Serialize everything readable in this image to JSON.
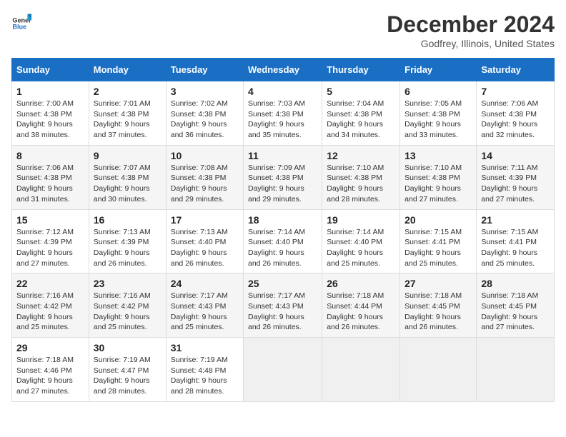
{
  "logo": {
    "line1": "General",
    "line2": "Blue"
  },
  "title": "December 2024",
  "subtitle": "Godfrey, Illinois, United States",
  "days_of_week": [
    "Sunday",
    "Monday",
    "Tuesday",
    "Wednesday",
    "Thursday",
    "Friday",
    "Saturday"
  ],
  "weeks": [
    [
      {
        "day": "1",
        "sunrise": "7:00 AM",
        "sunset": "4:38 PM",
        "daylight": "9 hours and 38 minutes."
      },
      {
        "day": "2",
        "sunrise": "7:01 AM",
        "sunset": "4:38 PM",
        "daylight": "9 hours and 37 minutes."
      },
      {
        "day": "3",
        "sunrise": "7:02 AM",
        "sunset": "4:38 PM",
        "daylight": "9 hours and 36 minutes."
      },
      {
        "day": "4",
        "sunrise": "7:03 AM",
        "sunset": "4:38 PM",
        "daylight": "9 hours and 35 minutes."
      },
      {
        "day": "5",
        "sunrise": "7:04 AM",
        "sunset": "4:38 PM",
        "daylight": "9 hours and 34 minutes."
      },
      {
        "day": "6",
        "sunrise": "7:05 AM",
        "sunset": "4:38 PM",
        "daylight": "9 hours and 33 minutes."
      },
      {
        "day": "7",
        "sunrise": "7:06 AM",
        "sunset": "4:38 PM",
        "daylight": "9 hours and 32 minutes."
      }
    ],
    [
      {
        "day": "8",
        "sunrise": "7:06 AM",
        "sunset": "4:38 PM",
        "daylight": "9 hours and 31 minutes."
      },
      {
        "day": "9",
        "sunrise": "7:07 AM",
        "sunset": "4:38 PM",
        "daylight": "9 hours and 30 minutes."
      },
      {
        "day": "10",
        "sunrise": "7:08 AM",
        "sunset": "4:38 PM",
        "daylight": "9 hours and 29 minutes."
      },
      {
        "day": "11",
        "sunrise": "7:09 AM",
        "sunset": "4:38 PM",
        "daylight": "9 hours and 29 minutes."
      },
      {
        "day": "12",
        "sunrise": "7:10 AM",
        "sunset": "4:38 PM",
        "daylight": "9 hours and 28 minutes."
      },
      {
        "day": "13",
        "sunrise": "7:10 AM",
        "sunset": "4:38 PM",
        "daylight": "9 hours and 27 minutes."
      },
      {
        "day": "14",
        "sunrise": "7:11 AM",
        "sunset": "4:39 PM",
        "daylight": "9 hours and 27 minutes."
      }
    ],
    [
      {
        "day": "15",
        "sunrise": "7:12 AM",
        "sunset": "4:39 PM",
        "daylight": "9 hours and 27 minutes."
      },
      {
        "day": "16",
        "sunrise": "7:13 AM",
        "sunset": "4:39 PM",
        "daylight": "9 hours and 26 minutes."
      },
      {
        "day": "17",
        "sunrise": "7:13 AM",
        "sunset": "4:40 PM",
        "daylight": "9 hours and 26 minutes."
      },
      {
        "day": "18",
        "sunrise": "7:14 AM",
        "sunset": "4:40 PM",
        "daylight": "9 hours and 26 minutes."
      },
      {
        "day": "19",
        "sunrise": "7:14 AM",
        "sunset": "4:40 PM",
        "daylight": "9 hours and 25 minutes."
      },
      {
        "day": "20",
        "sunrise": "7:15 AM",
        "sunset": "4:41 PM",
        "daylight": "9 hours and 25 minutes."
      },
      {
        "day": "21",
        "sunrise": "7:15 AM",
        "sunset": "4:41 PM",
        "daylight": "9 hours and 25 minutes."
      }
    ],
    [
      {
        "day": "22",
        "sunrise": "7:16 AM",
        "sunset": "4:42 PM",
        "daylight": "9 hours and 25 minutes."
      },
      {
        "day": "23",
        "sunrise": "7:16 AM",
        "sunset": "4:42 PM",
        "daylight": "9 hours and 25 minutes."
      },
      {
        "day": "24",
        "sunrise": "7:17 AM",
        "sunset": "4:43 PM",
        "daylight": "9 hours and 25 minutes."
      },
      {
        "day": "25",
        "sunrise": "7:17 AM",
        "sunset": "4:43 PM",
        "daylight": "9 hours and 26 minutes."
      },
      {
        "day": "26",
        "sunrise": "7:18 AM",
        "sunset": "4:44 PM",
        "daylight": "9 hours and 26 minutes."
      },
      {
        "day": "27",
        "sunrise": "7:18 AM",
        "sunset": "4:45 PM",
        "daylight": "9 hours and 26 minutes."
      },
      {
        "day": "28",
        "sunrise": "7:18 AM",
        "sunset": "4:45 PM",
        "daylight": "9 hours and 27 minutes."
      }
    ],
    [
      {
        "day": "29",
        "sunrise": "7:18 AM",
        "sunset": "4:46 PM",
        "daylight": "9 hours and 27 minutes."
      },
      {
        "day": "30",
        "sunrise": "7:19 AM",
        "sunset": "4:47 PM",
        "daylight": "9 hours and 28 minutes."
      },
      {
        "day": "31",
        "sunrise": "7:19 AM",
        "sunset": "4:48 PM",
        "daylight": "9 hours and 28 minutes."
      },
      null,
      null,
      null,
      null
    ]
  ],
  "labels": {
    "sunrise": "Sunrise:",
    "sunset": "Sunset:",
    "daylight": "Daylight:"
  }
}
